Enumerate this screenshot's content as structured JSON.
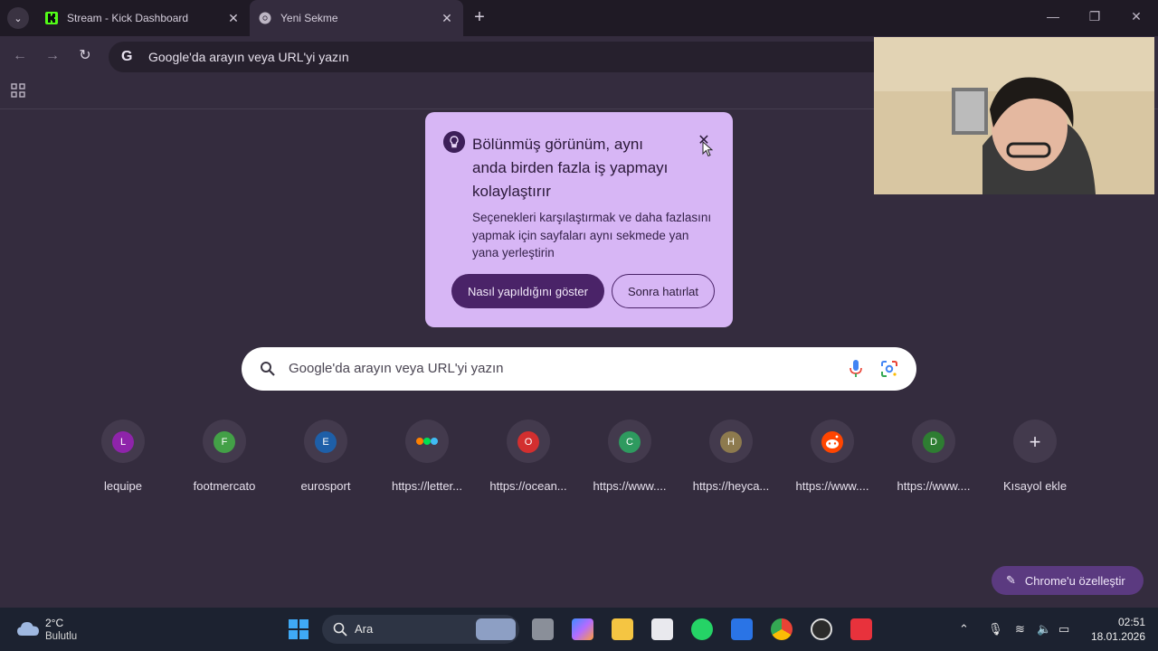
{
  "browser": {
    "tabs": [
      {
        "title": "Stream - Kick Dashboard",
        "active": false
      },
      {
        "title": "Yeni Sekme",
        "active": true
      }
    ],
    "omnibox_text": "Google'da arayın veya URL'yi yazın"
  },
  "popup": {
    "title": "Bölünmüş görünüm, aynı anda birden fazla iş yapmayı kolaylaştırır",
    "body": "Seçenekleri karşılaştırmak ve daha fazlasını yapmak için sayfaları aynı sekmede yan yana yerleştirin",
    "primary_button": "Nasıl yapıldığını göster",
    "secondary_button": "Sonra hatırlat"
  },
  "search": {
    "placeholder": "Google'da arayın veya URL'yi yazın"
  },
  "shortcuts": [
    {
      "letter": "L",
      "label": "lequipe",
      "color": "#8e24aa"
    },
    {
      "letter": "F",
      "label": "footmercato",
      "color": "#43a047"
    },
    {
      "letter": "E",
      "label": "eurosport",
      "color": "#1e5fa8"
    },
    {
      "letter": "",
      "label": "https://letter...",
      "color": "#433a4d"
    },
    {
      "letter": "O",
      "label": "https://ocean...",
      "color": "#d32f2f"
    },
    {
      "letter": "C",
      "label": "https://www....",
      "color": "#2e9a5f"
    },
    {
      "letter": "H",
      "label": "https://heyca...",
      "color": "#8d7a4e"
    },
    {
      "letter": "",
      "label": "https://www....",
      "color": "#ff4500"
    },
    {
      "letter": "D",
      "label": "https://www....",
      "color": "#2e7d32"
    },
    {
      "letter": "+",
      "label": "Kısayol ekle",
      "color": "#433a4d"
    }
  ],
  "customize_button": "Chrome'u özelleştir",
  "taskbar": {
    "temperature": "2°C",
    "condition": "Bulutlu",
    "search_label": "Ara",
    "time": "02:51",
    "date": "18.01.2026"
  },
  "colors": {
    "page_bg": "#342c3e",
    "popup_bg": "#d7b6f5",
    "accent": "#4a2368"
  }
}
